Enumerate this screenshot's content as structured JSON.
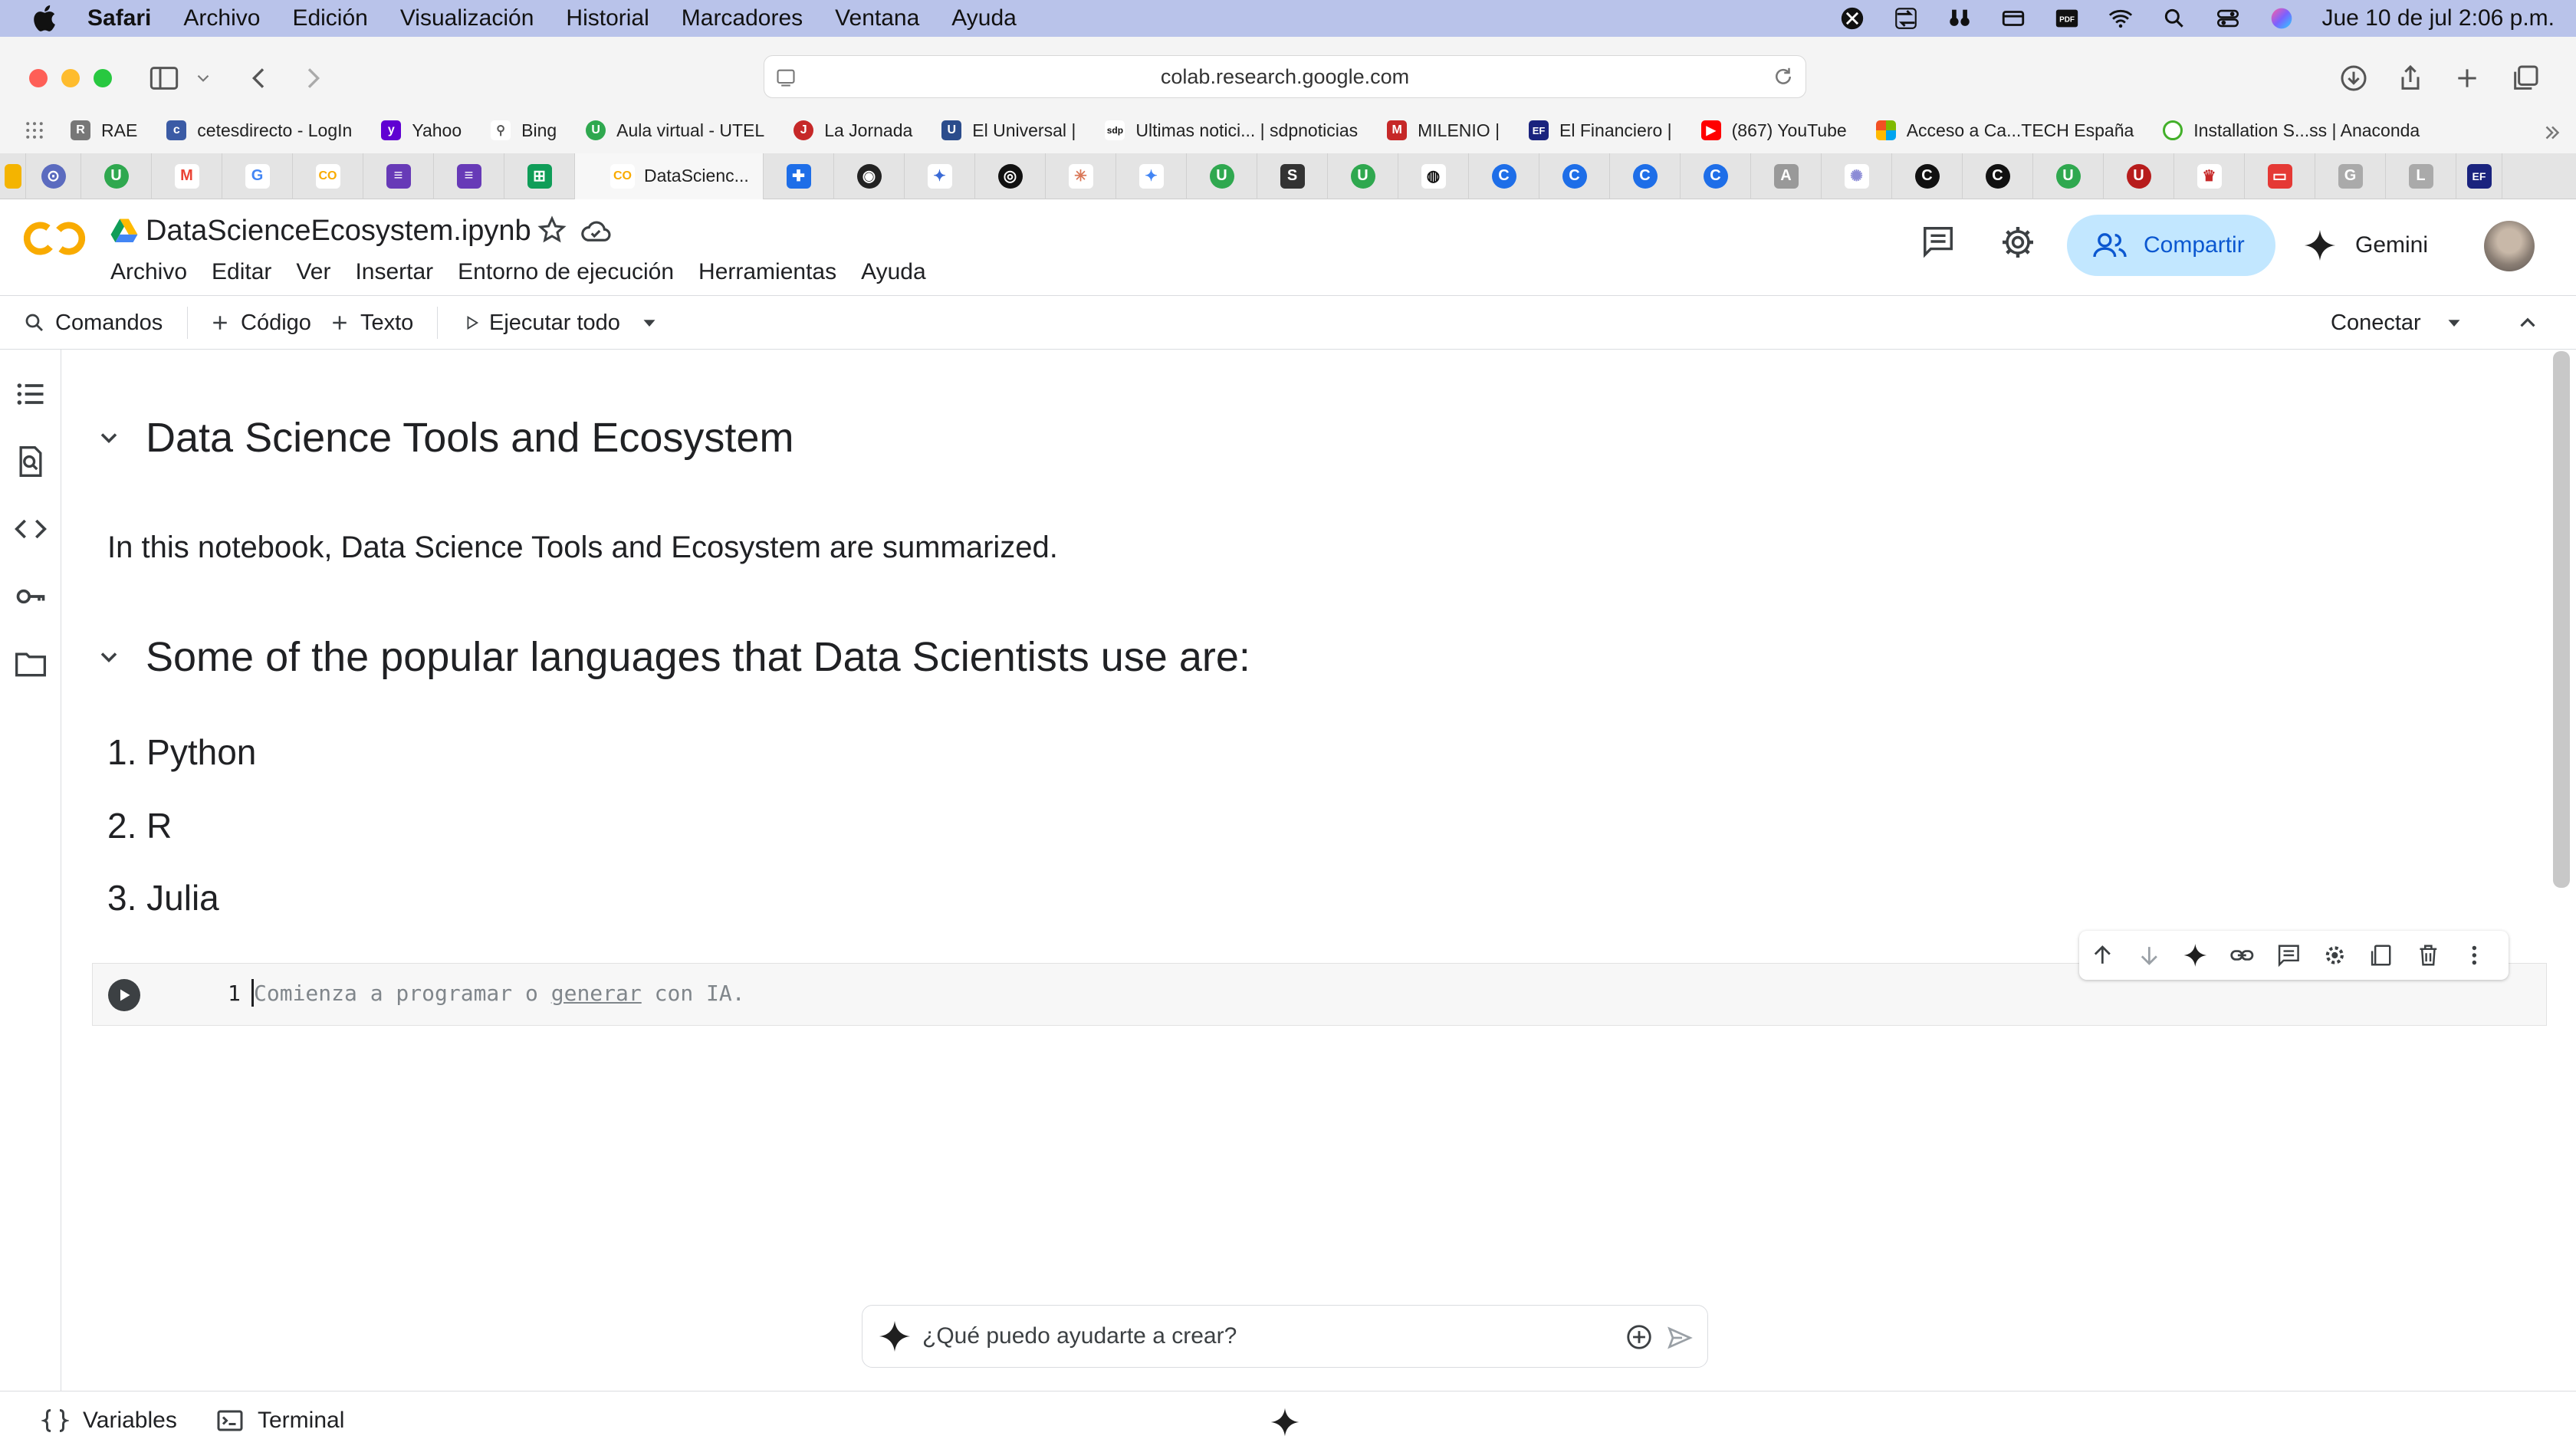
{
  "menubar": {
    "app": "Safari",
    "items": [
      "Archivo",
      "Edición",
      "Visualización",
      "Historial",
      "Marcadores",
      "Ventana",
      "Ayuda"
    ],
    "clock": "Jue 10 de jul  2:06 p.m."
  },
  "safari": {
    "url": "colab.research.google.com",
    "favorites": [
      {
        "label": "RAE",
        "icon": "rae-icon",
        "color": "#555"
      },
      {
        "label": "cetesdirecto - LogIn",
        "icon": "cetes-icon",
        "color": "#3b5ba5"
      },
      {
        "label": "Yahoo",
        "icon": "yahoo-icon",
        "color": "#6001d2"
      },
      {
        "label": "Bing",
        "icon": "bing-search-icon",
        "color": "#555"
      },
      {
        "label": "Aula virtual - UTEL",
        "icon": "utel-icon",
        "color": "#2fa84f"
      },
      {
        "label": "La Jornada",
        "icon": "la-jornada-icon",
        "color": "#c62828"
      },
      {
        "label": "El Universal |",
        "icon": "el-universal-icon",
        "color": "#2b4c8c"
      },
      {
        "label": "Ultimas notici... | sdpnoticias",
        "icon": "sdp-icon",
        "color": "#111"
      },
      {
        "label": "MILENIO |",
        "icon": "milenio-icon",
        "color": "#c62828"
      },
      {
        "label": "El Financiero |",
        "icon": "el-financiero-icon",
        "color": "#1a237e"
      },
      {
        "label": "(867) YouTube",
        "icon": "youtube-icon",
        "color": "#ff0000"
      },
      {
        "label": "Acceso a Ca...TECH España",
        "icon": "microsoft-icon",
        "color": "#f25022"
      },
      {
        "label": "Installation S...ss | Anaconda",
        "icon": "anaconda-icon",
        "color": "#43b02a"
      }
    ],
    "active_tab": "DataScienc..."
  },
  "colab": {
    "title": "DataScienceEcosystem.ipynb",
    "menu": [
      "Archivo",
      "Editar",
      "Ver",
      "Insertar",
      "Entorno de ejecución",
      "Herramientas",
      "Ayuda"
    ],
    "share": "Compartir",
    "gemini": "Gemini",
    "toolbar": {
      "commands": "Comandos",
      "code": "Código",
      "text": "Texto",
      "run_all": "Ejecutar todo",
      "connect": "Conectar"
    },
    "notebook": {
      "heading1": "Data Science Tools and Ecosystem",
      "intro": "In this notebook, Data Science Tools and Ecosystem are summarized.",
      "heading2": "Some of the popular languages that Data Scientists use are:",
      "languages": [
        "1. Python",
        "2. R",
        "3. Julia"
      ]
    },
    "code_cell": {
      "line_number": "1",
      "placeholder_pre": "Comienza a programar o ",
      "placeholder_link": "generar",
      "placeholder_post": " con IA."
    },
    "ai_prompt": {
      "placeholder": "¿Qué puedo ayudarte a crear?"
    },
    "statusbar": {
      "variables": "Variables",
      "terminal": "Terminal"
    }
  },
  "colors": {
    "accent_blue": "#0b57d0",
    "share_bg": "#c2e7ff",
    "colab_orange": "#f9ab00",
    "menubar_bg": "#b9c3ea"
  }
}
